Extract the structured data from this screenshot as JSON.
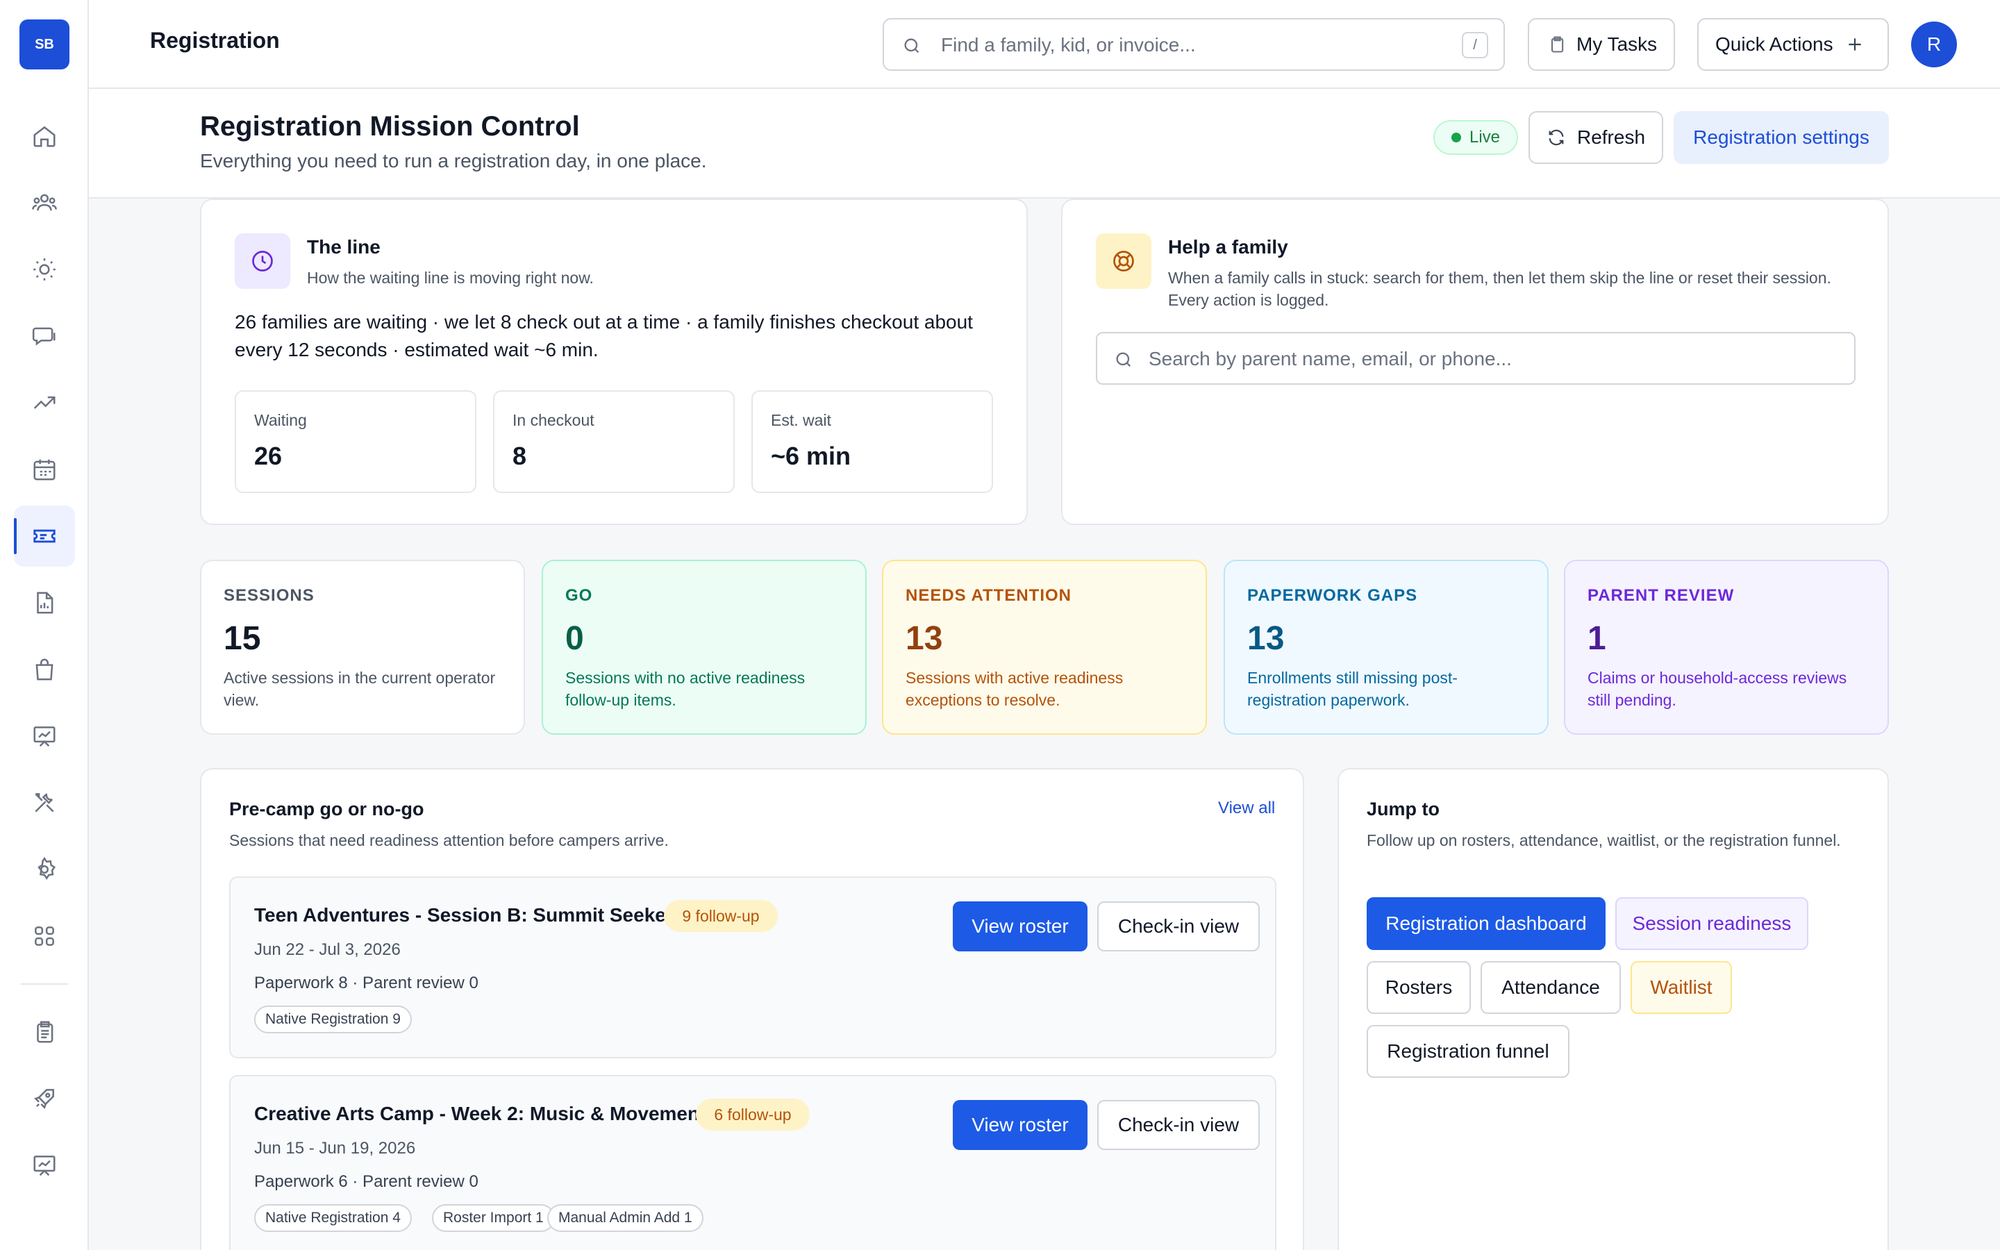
{
  "app": {
    "logo": "SB",
    "page": "Registration",
    "user_initial": "R"
  },
  "search": {
    "placeholder": "Find a family, kid, or invoice...",
    "shortcut": "/"
  },
  "topbar": {
    "tasks_label": "My Tasks",
    "quick_label": "Quick Actions"
  },
  "sidebar": {
    "items": [
      "home-icon",
      "families-icon",
      "sun-icon",
      "messages-icon",
      "trending-icon",
      "calendar-icon",
      "ticket-icon",
      "report-icon",
      "shop-icon",
      "presentation-icon",
      "tools-icon",
      "settings-icon",
      "apps-icon",
      "clipboard-icon",
      "rocket-icon",
      "analytics-icon"
    ],
    "active": "ticket-icon"
  },
  "header": {
    "title": "Registration Mission Control",
    "subtitle": "Everything you need to run a registration day, in one place.",
    "live": "Live",
    "refresh": "Refresh",
    "settings": "Registration settings"
  },
  "line": {
    "title": "The line",
    "subtitle": "How the waiting line is moving right now.",
    "description": "26 families are waiting · we let 8 check out at a time · a family finishes checkout about every 12 seconds · estimated wait ~6 min.",
    "metrics": [
      {
        "label": "Waiting",
        "value": "26"
      },
      {
        "label": "In checkout",
        "value": "8"
      },
      {
        "label": "Est. wait",
        "value": "~6 min"
      }
    ]
  },
  "help": {
    "title": "Help a family",
    "subtitle": "When a family calls in stuck: search for them, then let them skip the line or reset their session. Every action is logged.",
    "placeholder": "Search by parent name, email, or phone..."
  },
  "stats": [
    {
      "label": "SESSIONS",
      "value": "15",
      "desc": "Active sessions in the current operator view."
    },
    {
      "label": "GO",
      "value": "0",
      "desc": "Sessions with no active readiness follow-up items."
    },
    {
      "label": "NEEDS ATTENTION",
      "value": "13",
      "desc": "Sessions with active readiness exceptions to resolve."
    },
    {
      "label": "PAPERWORK GAPS",
      "value": "13",
      "desc": "Enrollments still missing post-registration paperwork."
    },
    {
      "label": "PARENT REVIEW",
      "value": "1",
      "desc": "Claims or household-access reviews still pending."
    }
  ],
  "gonogo": {
    "title": "Pre-camp go or no-go",
    "subtitle": "Sessions that need readiness attention before campers arrive.",
    "view_all": "View all",
    "sessions": [
      {
        "name": "Teen Adventures - Session B: Summit Seekers",
        "badge": "9 follow-up",
        "dates": "Jun 22 - Jul 3, 2026",
        "meta": "Paperwork 8 · Parent review 0",
        "chips": [
          "Native Registration 9"
        ]
      },
      {
        "name": "Creative Arts Camp - Week 2: Music & Movement",
        "badge": "6 follow-up",
        "dates": "Jun 15 - Jun 19, 2026",
        "meta": "Paperwork 6 · Parent review 0",
        "chips": [
          "Native Registration 4",
          "Roster Import 1",
          "Manual Admin Add 1"
        ]
      }
    ],
    "view_roster": "View roster",
    "checkin_view": "Check-in view"
  },
  "jump": {
    "title": "Jump to",
    "subtitle": "Follow up on rosters, attendance, waitlist, or the registration funnel.",
    "links": [
      "Registration dashboard",
      "Session readiness",
      "Rosters",
      "Attendance",
      "Waitlist",
      "Registration funnel"
    ]
  },
  "colors": {
    "accent": "#1d4ed8",
    "go": "#ecfdf5",
    "attention": "#fffbeb",
    "paperwork": "#f0f9ff",
    "review": "#f5f3ff"
  }
}
